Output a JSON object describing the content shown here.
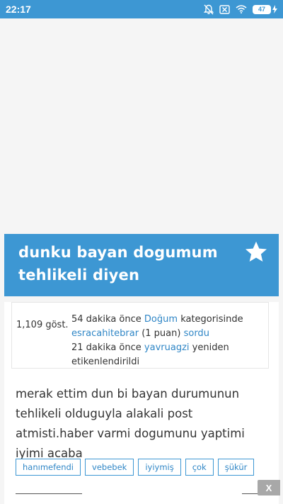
{
  "status_bar": {
    "time": "22:17",
    "battery": "47",
    "icons": [
      "bell-off-icon",
      "close-box-icon",
      "wifi-icon",
      "battery-icon",
      "charging-icon"
    ]
  },
  "question": {
    "title": "dunku bayan dogumum tehlikeli diyen",
    "views": "1,109 göst.",
    "asked_time": "54 dakika önce",
    "category": "Doğum",
    "category_suffix": "kategorisinde",
    "asker": "esracahitebrar",
    "asker_points": "(1 puan)",
    "asked_verb": "sordu",
    "retag_time": "21 dakika önce",
    "retagger": "yavruagzi",
    "retag_suffix": "yeniden etikenlendirildi",
    "body": "merak ettim dun bi bayan durumunun tehlikeli olduguyla alakali post atmisti.haber varmi dogumunu yaptimi iyimi acaba",
    "tags": [
      "hanımefendi",
      "vebebek",
      "iyiymiş",
      "çok",
      "şükür"
    ]
  },
  "ad": {
    "close_label": "X"
  },
  "colors": {
    "accent": "#3d97d3",
    "link": "#2f86c6",
    "background": "#f5f5f5"
  }
}
